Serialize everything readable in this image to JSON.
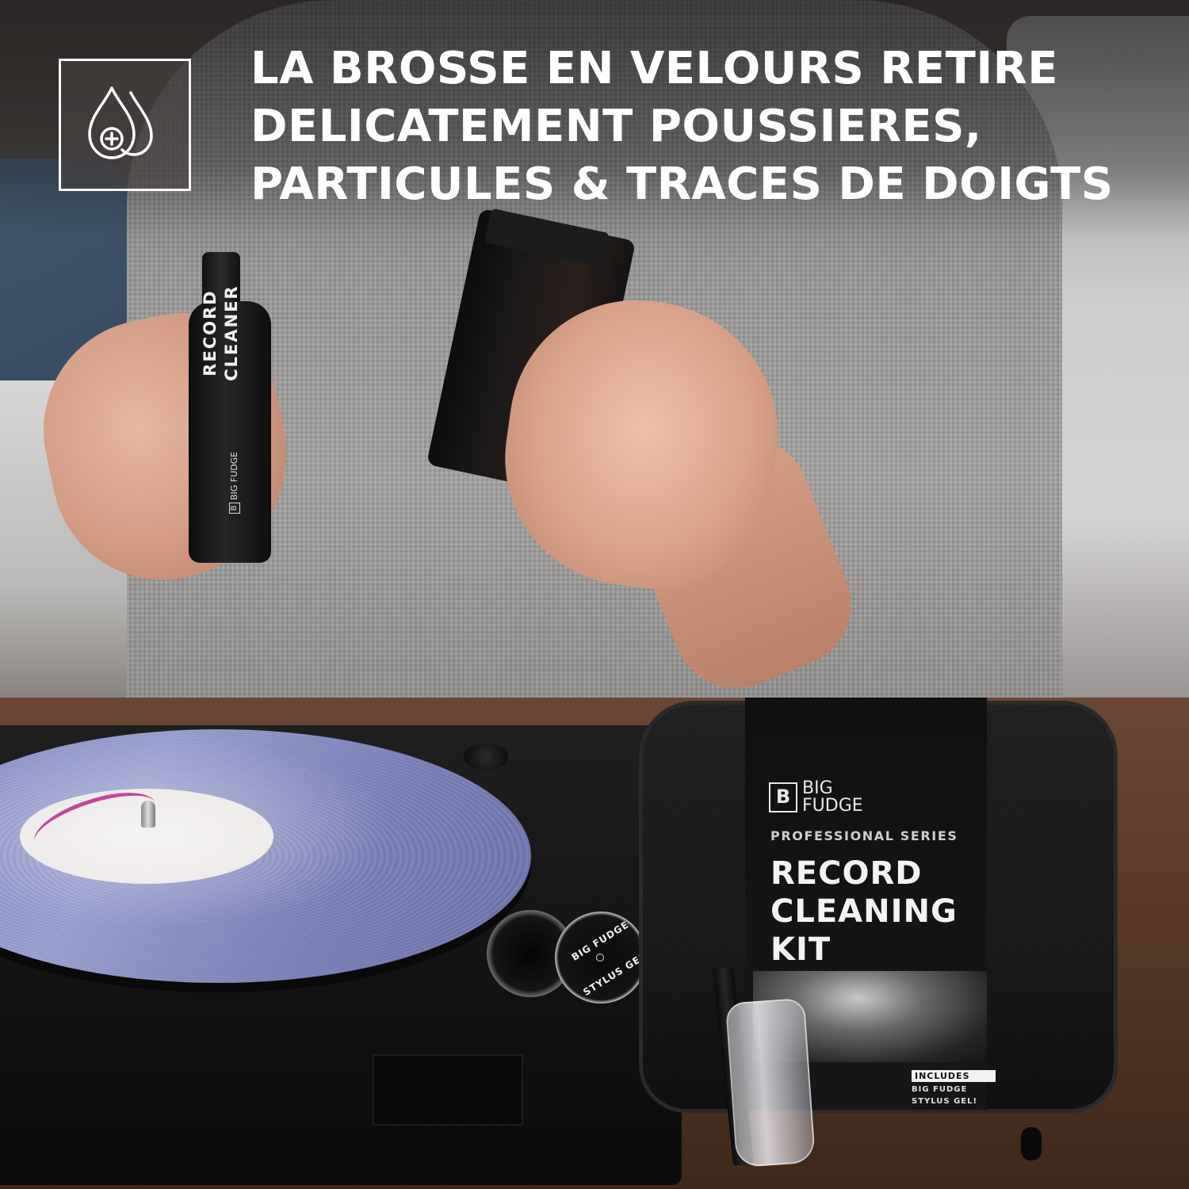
{
  "headline": {
    "line1": "LA BROSSE EN VELOURS RETIRE",
    "line2": "DELICATEMENT POUSSIERES,",
    "line3": "PARTICULES & TRACES DE DOIGTS"
  },
  "badge": {
    "icon": "water-drops-plus-icon"
  },
  "bottle": {
    "line1": "RECORD",
    "line2": "CLEANER",
    "brand": "BIG FUDGE"
  },
  "jar": {
    "top_text": "BIG FUDGE",
    "bottom_text": "STYLUS GEL"
  },
  "case": {
    "brand_line1": "BIG",
    "brand_line2": "FUDGE",
    "series": "PROFESSIONAL SERIES",
    "title_line1": "RECORD",
    "title_line2": "CLEANING",
    "title_line3": "KIT",
    "includes_tag": "INCLUDES",
    "includes_line1": "BIG FUDGE",
    "includes_line2": "STYLUS GEL!"
  },
  "colors": {
    "headline": "#ffffff",
    "record": "#8a8fc6",
    "label_accent": "#c2459a",
    "case": "#1a1a1a"
  }
}
